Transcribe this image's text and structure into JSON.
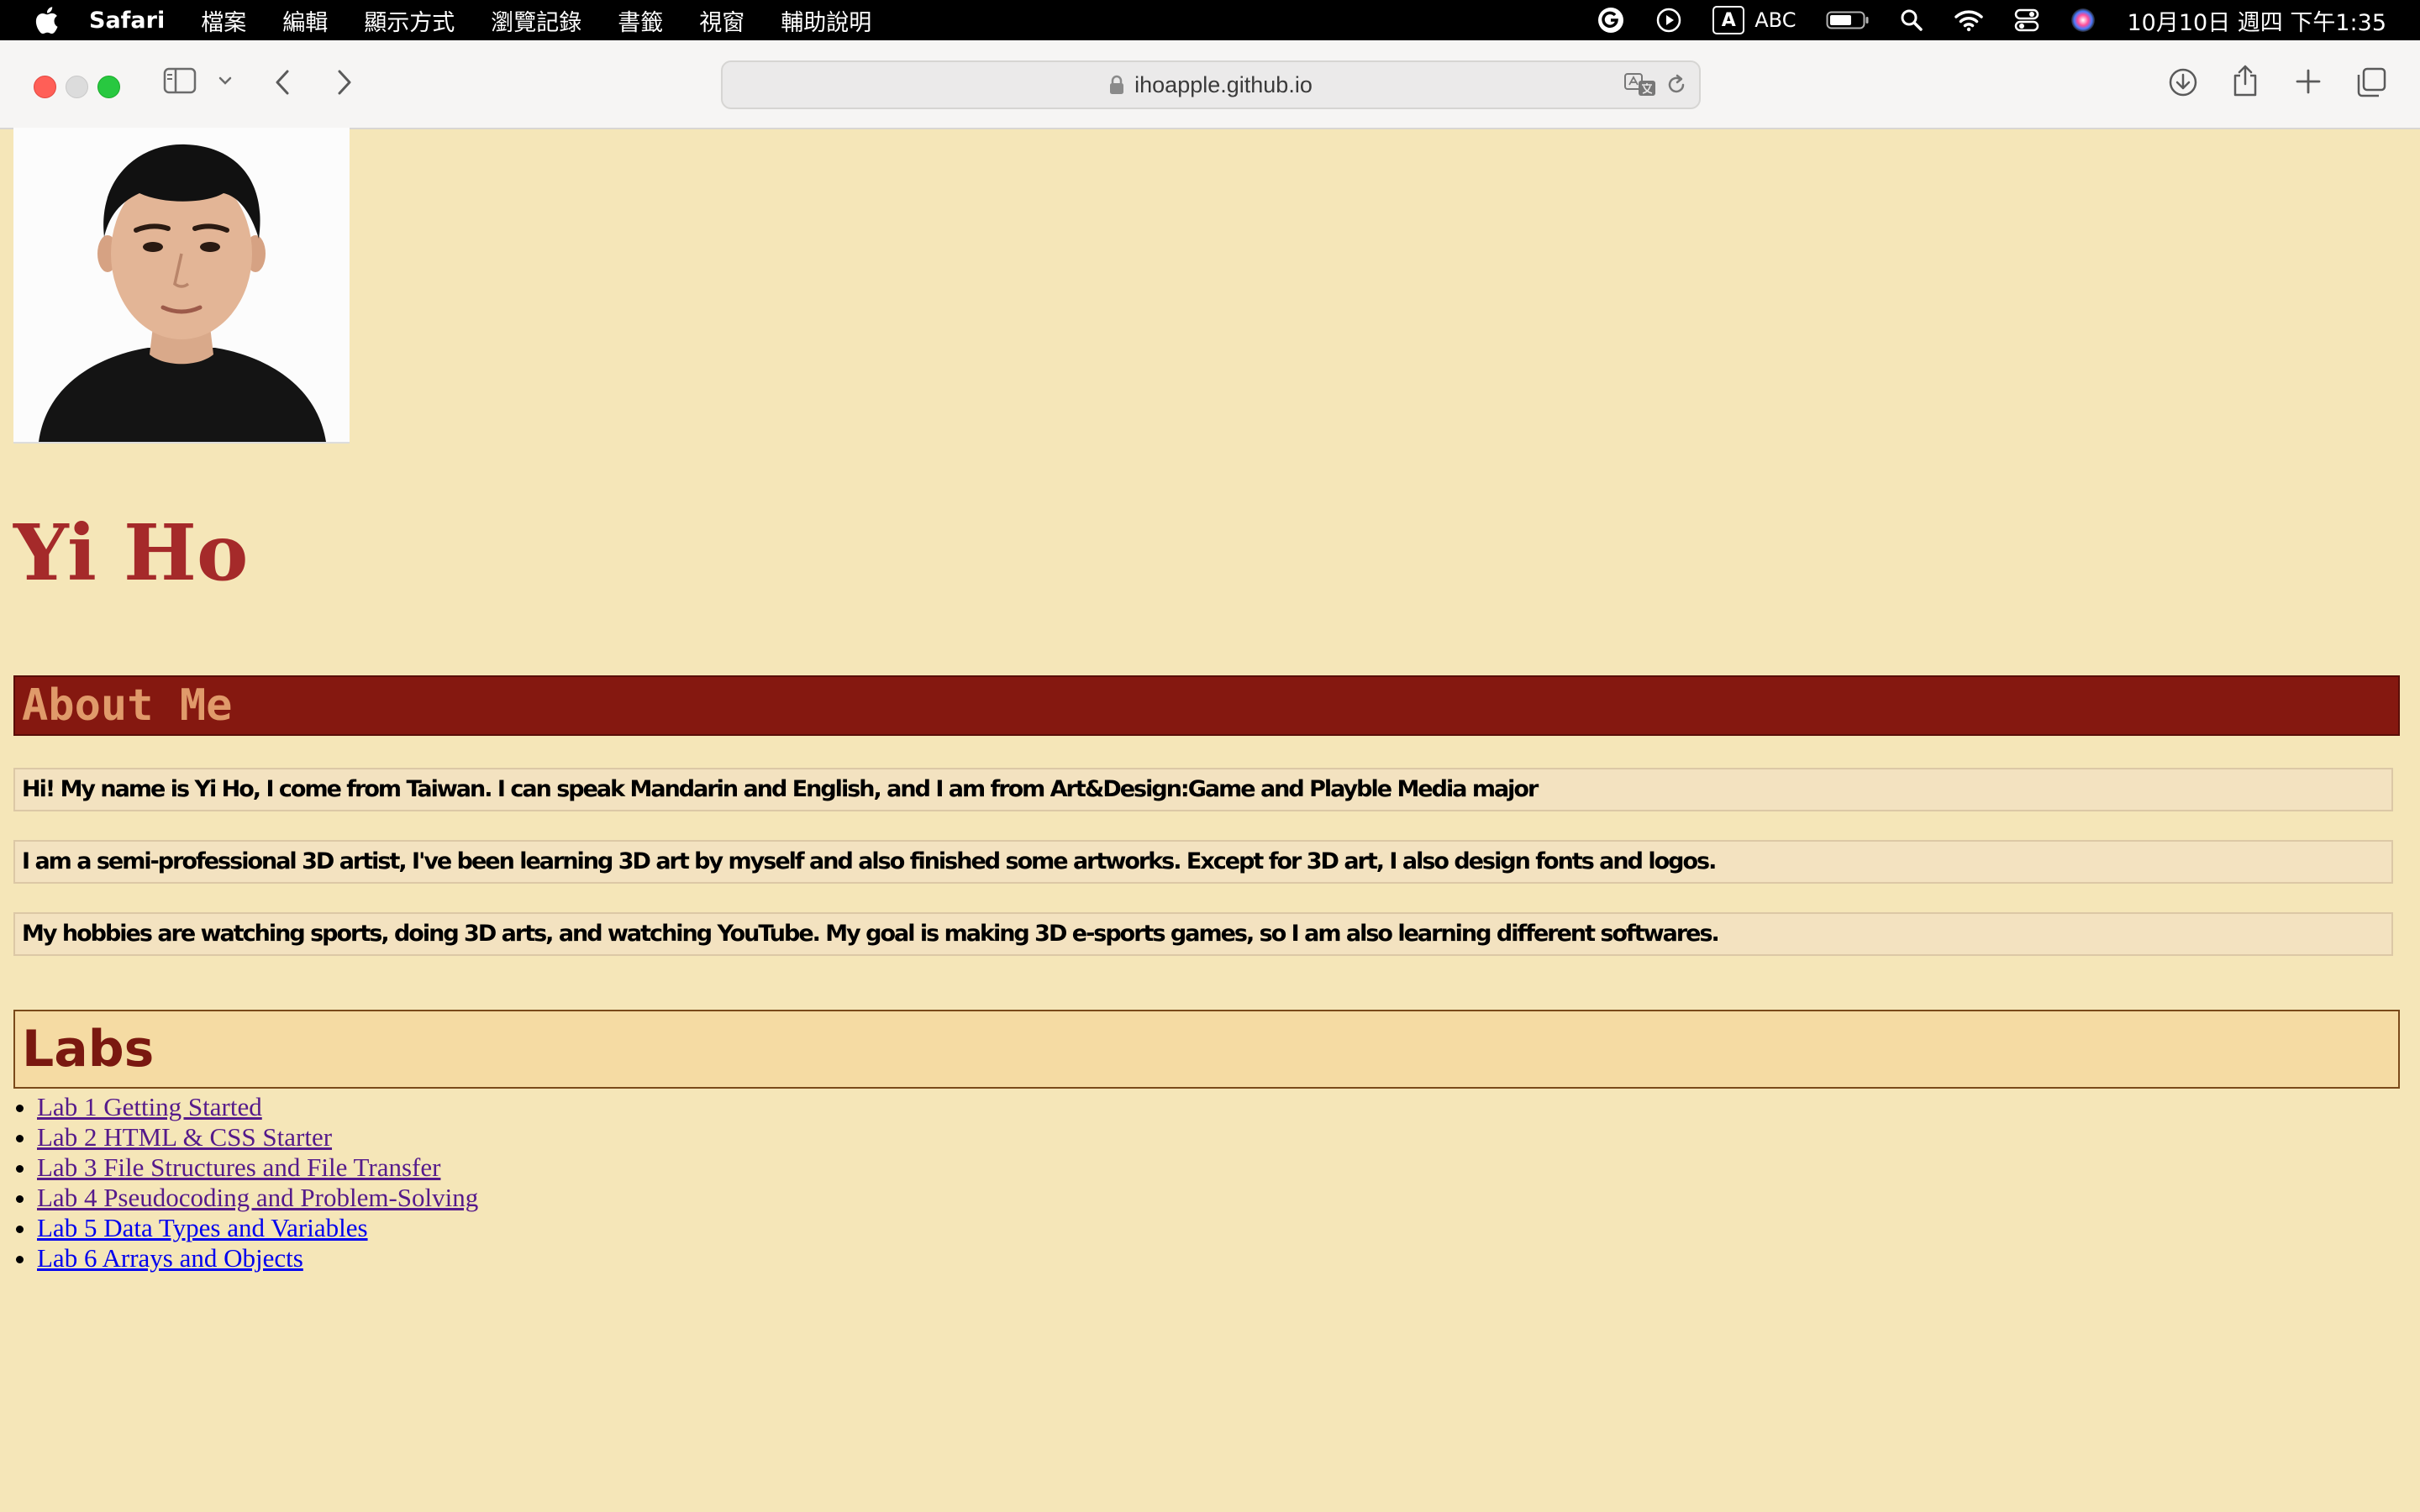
{
  "menubar": {
    "app_name": "Safari",
    "menus": [
      "檔案",
      "編輯",
      "顯示方式",
      "瀏覽記錄",
      "書籤",
      "視窗",
      "輔助說明"
    ],
    "input_badge": "A",
    "input_source": "ABC",
    "clock": "10月10日 週四 下午1:35"
  },
  "browser": {
    "url": "ihoapple.github.io"
  },
  "profile": {
    "name": "Yi Ho"
  },
  "about": {
    "heading": "About Me",
    "paragraphs": [
      "Hi! My name is Yi Ho, I come from Taiwan. I can speak Mandarin and English, and I am from Art&Design:Game and Playble Media major",
      "I am a semi-professional 3D artist, I've been learning 3D art by myself and also finished some artworks. Except for 3D art, I also design fonts and logos.",
      "My hobbies are watching sports, doing 3D arts, and watching YouTube. My goal is making 3D e-sports games, so I am also learning different softwares."
    ]
  },
  "labs": {
    "heading": "Labs",
    "items": [
      {
        "label": "Lab 1 Getting Started",
        "visited": true
      },
      {
        "label": "Lab 2 HTML & CSS Starter",
        "visited": true
      },
      {
        "label": "Lab 3 File Structures and File Transfer",
        "visited": true
      },
      {
        "label": "Lab 4 Pseudocoding and Problem-Solving",
        "visited": true
      },
      {
        "label": "Lab 5 Data Types and Variables",
        "visited": false
      },
      {
        "label": "Lab 6 Arrays and Objects",
        "visited": false
      }
    ]
  },
  "colors": {
    "page_background": "#f5e6b8",
    "name_color": "#a52a2a",
    "about_heading_bg": "#851810",
    "about_heading_text": "#e09a6a",
    "labs_heading_bg": "#f5dba3",
    "labs_heading_text": "#7a1810",
    "visited_link": "#551a8b",
    "unvisited_link": "#0000ee"
  },
  "icons": {
    "menubar_left": "apple-logo-icon",
    "menubar_right": [
      "grammarly-icon",
      "play-circle-icon",
      "input-source-icon",
      "battery-icon",
      "spotlight-search-icon",
      "wifi-icon",
      "control-center-icon",
      "siri-icon"
    ],
    "toolbar": [
      "sidebar-toggle-icon",
      "chevron-down-icon",
      "back-arrow-icon",
      "forward-arrow-icon",
      "lock-icon",
      "translate-icon",
      "reload-icon",
      "downloads-icon",
      "share-icon",
      "new-tab-plus-icon",
      "tab-overview-icon"
    ]
  }
}
